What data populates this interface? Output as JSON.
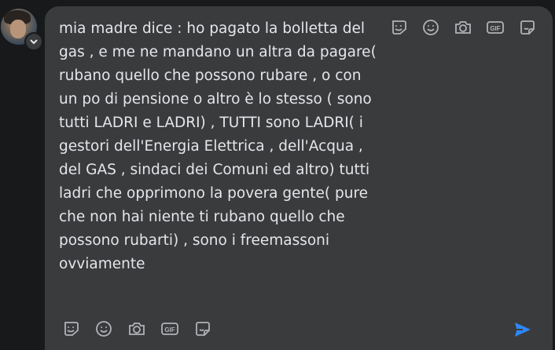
{
  "message": {
    "text": "mia madre dice : ho pagato la bolletta del gas , e me ne mandano un altra da pagare( rubano quello che possono rubare , o con un po di pensione o altro è lo stesso ( sono tutti LADRI e LADRI) , TUTTI sono LADRI( i gestori dell'Energia Elettrica , dell'Acqua , del GAS , sindaci dei Comuni ed altro) tutti ladri che opprimono la povera gente( pure che non hai niente ti rubano quello che possono rubarti) , sono i freemassoni ovviamente"
  },
  "toolbar_icons": [
    "sticker-icon",
    "emoji-icon",
    "camera-icon",
    "gif-icon",
    "avatar-sticker-icon"
  ],
  "gif_label": "GIF",
  "colors": {
    "background": "#18191a",
    "composer": "#3a3b3c",
    "text": "#e4e6eb",
    "icon": "#b0b3b8",
    "send": "#2d88ff"
  }
}
